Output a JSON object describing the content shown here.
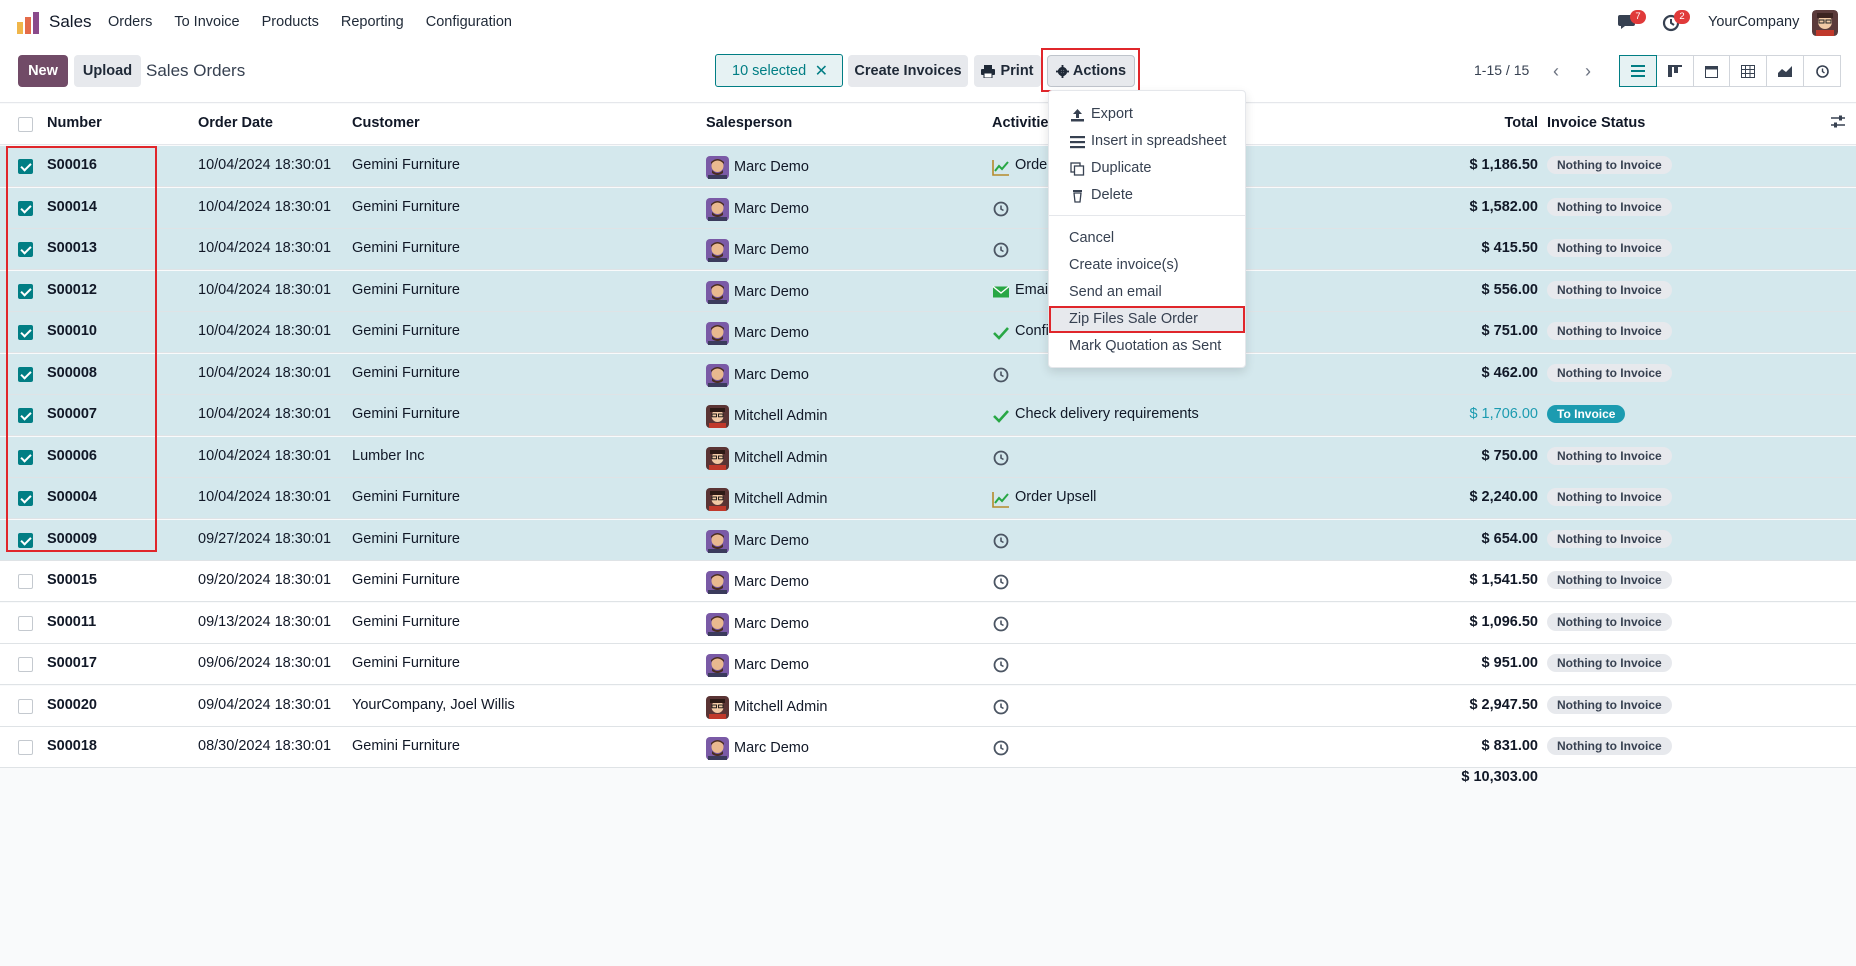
{
  "navbar": {
    "app_name": "Sales",
    "menu": [
      "Orders",
      "To Invoice",
      "Products",
      "Reporting",
      "Configuration"
    ],
    "chat_badge": "7",
    "activity_badge": "2",
    "company": "YourCompany"
  },
  "control_panel": {
    "new_label": "New",
    "upload_label": "Upload",
    "breadcrumb": "Sales Orders",
    "selected_label": "10 selected",
    "create_invoices_label": "Create Invoices",
    "print_label": "Print",
    "actions_label": "Actions",
    "pager": "1-15 / 15"
  },
  "columns": {
    "number": "Number",
    "order_date": "Order Date",
    "customer": "Customer",
    "salesperson": "Salesperson",
    "activities": "Activities",
    "total": "Total",
    "invoice_status": "Invoice Status"
  },
  "rows": [
    {
      "selected": true,
      "number": "S00016",
      "date": "10/04/2024 18:30:01",
      "customer": "Gemini Furniture",
      "salesperson": "Marc Demo",
      "activity": "Orde",
      "activity_icon": "chart-icon",
      "total": "$ 1,186.50",
      "status": "Nothing to Invoice"
    },
    {
      "selected": true,
      "number": "S00014",
      "date": "10/04/2024 18:30:01",
      "customer": "Gemini Furniture",
      "salesperson": "Marc Demo",
      "activity": "",
      "activity_icon": "clock-icon",
      "total": "$ 1,582.00",
      "status": "Nothing to Invoice"
    },
    {
      "selected": true,
      "number": "S00013",
      "date": "10/04/2024 18:30:01",
      "customer": "Gemini Furniture",
      "salesperson": "Marc Demo",
      "activity": "",
      "activity_icon": "clock-icon",
      "total": "$ 415.50",
      "status": "Nothing to Invoice"
    },
    {
      "selected": true,
      "number": "S00012",
      "date": "10/04/2024 18:30:01",
      "customer": "Gemini Furniture",
      "salesperson": "Marc Demo",
      "activity": "Emai",
      "activity_icon": "envelope-icon",
      "total": "$ 556.00",
      "status": "Nothing to Invoice"
    },
    {
      "selected": true,
      "number": "S00010",
      "date": "10/04/2024 18:30:01",
      "customer": "Gemini Furniture",
      "salesperson": "Marc Demo",
      "activity": "Confi",
      "activity_icon": "check-icon",
      "total": "$ 751.00",
      "status": "Nothing to Invoice"
    },
    {
      "selected": true,
      "number": "S00008",
      "date": "10/04/2024 18:30:01",
      "customer": "Gemini Furniture",
      "salesperson": "Marc Demo",
      "activity": "",
      "activity_icon": "clock-icon",
      "total": "$ 462.00",
      "status": "Nothing to Invoice"
    },
    {
      "selected": true,
      "number": "S00007",
      "date": "10/04/2024 18:30:01",
      "customer": "Gemini Furniture",
      "salesperson": "Mitchell Admin",
      "activity": "Check delivery requirements",
      "activity_icon": "check-icon",
      "total": "$ 1,706.00",
      "status": "To Invoice"
    },
    {
      "selected": true,
      "number": "S00006",
      "date": "10/04/2024 18:30:01",
      "customer": "Lumber Inc",
      "salesperson": "Mitchell Admin",
      "activity": "",
      "activity_icon": "clock-icon",
      "total": "$ 750.00",
      "status": "Nothing to Invoice"
    },
    {
      "selected": true,
      "number": "S00004",
      "date": "10/04/2024 18:30:01",
      "customer": "Gemini Furniture",
      "salesperson": "Mitchell Admin",
      "activity": "Order Upsell",
      "activity_icon": "chart-icon",
      "total": "$ 2,240.00",
      "status": "Nothing to Invoice"
    },
    {
      "selected": true,
      "number": "S00009",
      "date": "09/27/2024 18:30:01",
      "customer": "Gemini Furniture",
      "salesperson": "Marc Demo",
      "activity": "",
      "activity_icon": "clock-icon",
      "total": "$ 654.00",
      "status": "Nothing to Invoice"
    },
    {
      "selected": false,
      "number": "S00015",
      "date": "09/20/2024 18:30:01",
      "customer": "Gemini Furniture",
      "salesperson": "Marc Demo",
      "activity": "",
      "activity_icon": "clock-icon",
      "total": "$ 1,541.50",
      "status": "Nothing to Invoice"
    },
    {
      "selected": false,
      "number": "S00011",
      "date": "09/13/2024 18:30:01",
      "customer": "Gemini Furniture",
      "salesperson": "Marc Demo",
      "activity": "",
      "activity_icon": "clock-icon",
      "total": "$ 1,096.50",
      "status": "Nothing to Invoice"
    },
    {
      "selected": false,
      "number": "S00017",
      "date": "09/06/2024 18:30:01",
      "customer": "Gemini Furniture",
      "salesperson": "Marc Demo",
      "activity": "",
      "activity_icon": "clock-icon",
      "total": "$ 951.00",
      "status": "Nothing to Invoice"
    },
    {
      "selected": false,
      "number": "S00020",
      "date": "09/04/2024 18:30:01",
      "customer": "YourCompany, Joel Willis",
      "salesperson": "Mitchell Admin",
      "activity": "",
      "activity_icon": "clock-icon",
      "total": "$ 2,947.50",
      "status": "Nothing to Invoice"
    },
    {
      "selected": false,
      "number": "S00018",
      "date": "08/30/2024 18:30:01",
      "customer": "Gemini Furniture",
      "salesperson": "Marc Demo",
      "activity": "",
      "activity_icon": "clock-icon",
      "total": "$ 831.00",
      "status": "Nothing to Invoice"
    }
  ],
  "sum_total": "$ 10,303.00",
  "actions_menu": {
    "items_top": [
      {
        "label": "Export",
        "icon": "upload-icon"
      },
      {
        "label": "Insert in spreadsheet",
        "icon": "list-icon"
      },
      {
        "label": "Duplicate",
        "icon": "copy-icon"
      },
      {
        "label": "Delete",
        "icon": "trash-icon"
      }
    ],
    "items_bottom": [
      "Cancel",
      "Create invoice(s)",
      "Send an email",
      "Zip Files Sale Order",
      "Mark Quotation as Sent"
    ],
    "highlighted": "Zip Files Sale Order"
  },
  "colors": {
    "brand": "#714b67",
    "accent": "#017e84",
    "selected_row": "#d4e8ed",
    "highlight_box": "#e0262b",
    "to_invoice_badge": "#1b9bb0"
  }
}
